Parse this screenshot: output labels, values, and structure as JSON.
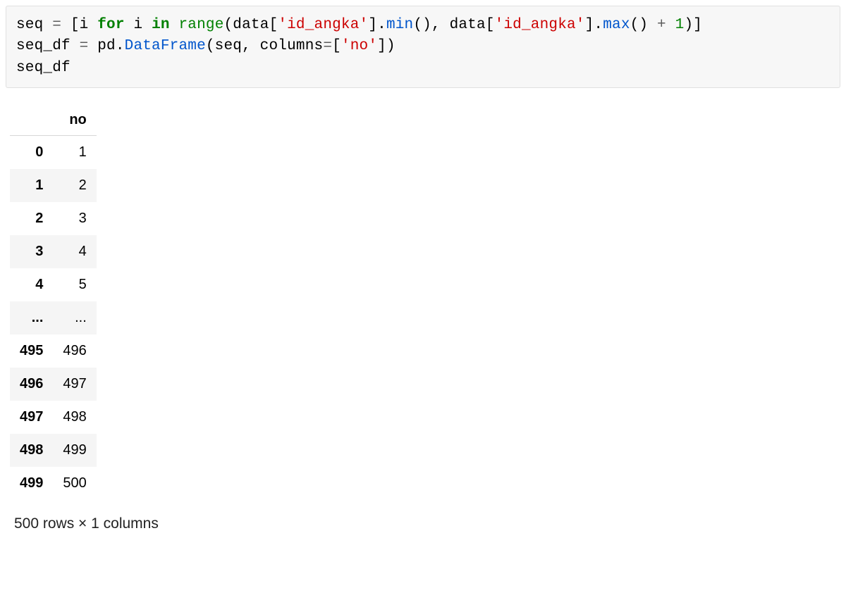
{
  "code": {
    "line1": {
      "t0": "seq ",
      "op0": "=",
      "t1": " [i ",
      "kw_for": "for",
      "t2": " i ",
      "kw_in": "in",
      "t3": " ",
      "fn_range": "range",
      "t4": "(data[",
      "str1": "'id_angka'",
      "t5": "].",
      "fn_min": "min",
      "t6": "(), data[",
      "str2": "'id_angka'",
      "t7": "].",
      "fn_max": "max",
      "t8": "() ",
      "op_plus": "+",
      "t9": " ",
      "num1": "1",
      "t10": ")]"
    },
    "line2": {
      "t0": "seq_df ",
      "op0": "=",
      "t1": " pd.",
      "fn_df": "DataFrame",
      "t2": "(seq, columns",
      "op1": "=",
      "t3": "[",
      "str1": "'no'",
      "t4": "])"
    },
    "line3": {
      "t0": "seq_df"
    }
  },
  "table": {
    "col_header": "no",
    "rows": [
      {
        "idx": "0",
        "no": "1"
      },
      {
        "idx": "1",
        "no": "2"
      },
      {
        "idx": "2",
        "no": "3"
      },
      {
        "idx": "3",
        "no": "4"
      },
      {
        "idx": "4",
        "no": "5"
      },
      {
        "idx": "...",
        "no": "..."
      },
      {
        "idx": "495",
        "no": "496"
      },
      {
        "idx": "496",
        "no": "497"
      },
      {
        "idx": "497",
        "no": "498"
      },
      {
        "idx": "498",
        "no": "499"
      },
      {
        "idx": "499",
        "no": "500"
      }
    ]
  },
  "shape_text": "500 rows × 1 columns"
}
